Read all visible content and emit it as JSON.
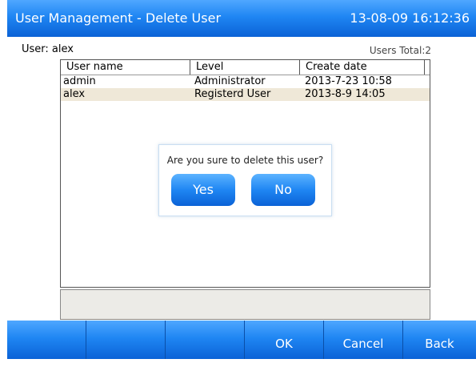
{
  "titlebar": {
    "title": "User Management - Delete User",
    "datetime": "13-08-09 16:12:36"
  },
  "current_user": "User: alex",
  "users_total": "Users Total:2",
  "table": {
    "columns": [
      "User name",
      "Level",
      "Create date"
    ],
    "rows": [
      [
        "admin",
        "Administrator",
        "2013-7-23 10:58"
      ],
      [
        "alex",
        "Registerd User",
        "2013-8-9 14:05"
      ]
    ],
    "selected_row": 1
  },
  "dialog": {
    "message": "Are you sure to delete this user?",
    "yes_label": "Yes",
    "no_label": "No"
  },
  "bottom_bar": {
    "buttons": [
      "",
      "",
      "",
      "OK",
      "Cancel",
      "Back"
    ]
  },
  "colors": {
    "accent": "#1f86f3",
    "selected_row": "#efe8d8",
    "status_panel": "#ecebe7"
  }
}
